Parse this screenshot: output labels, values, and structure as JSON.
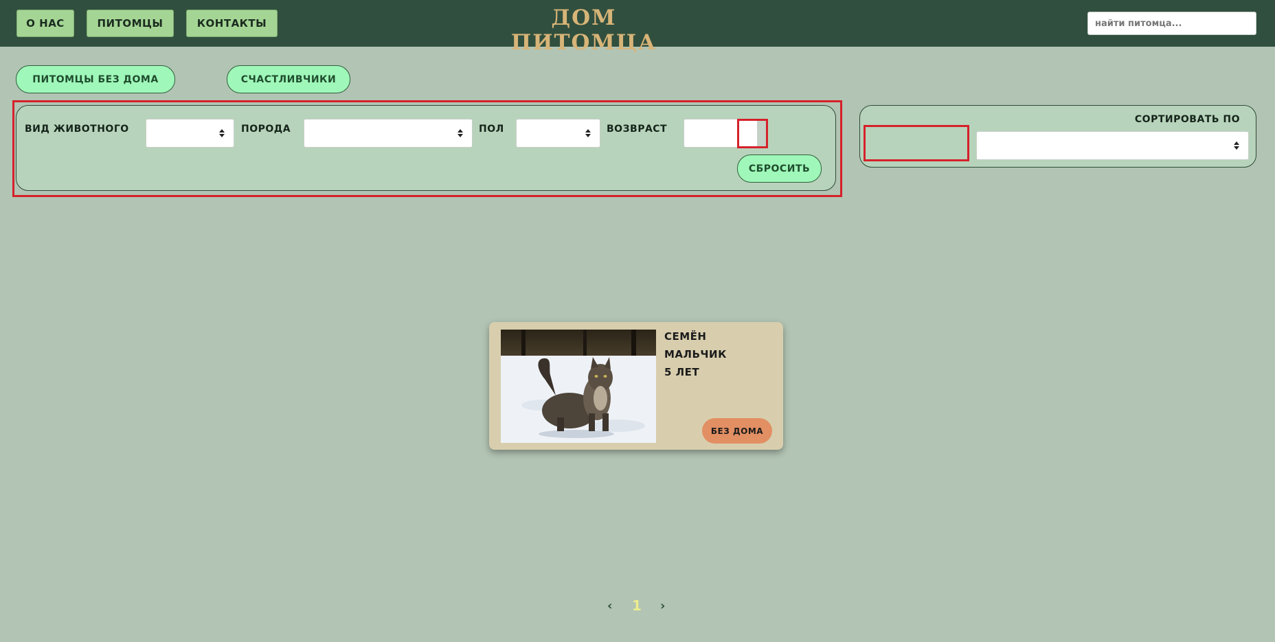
{
  "nav": {
    "about": "О НАС",
    "pets": "ПИТОМЦЫ",
    "contacts": "КОНТАКТЫ"
  },
  "site_title": "ДОМ ПИТОМЦА",
  "search": {
    "placeholder": "найти питомца..."
  },
  "categories": {
    "homeless": "ПИТОМЦЫ БЕЗ ДОМА",
    "lucky": "СЧАСТЛИВЧИКИ"
  },
  "filters": {
    "animal_type_label": "ВИД ЖИВОТНОГО",
    "breed_label": "ПОРОДА",
    "gender_label": "ПОЛ",
    "age_label": "ВОЗВРАСТ",
    "reset": "СБРОСИТЬ"
  },
  "sort": {
    "label": "СОРТИРОВАТЬ ПО"
  },
  "pet": {
    "name": "СЕМЁН",
    "gender": "МАЛЬЧИК",
    "age": "5 ЛЕТ",
    "status": "БЕЗ ДОМА"
  },
  "pagination": {
    "prev": "‹",
    "current": "1",
    "next": "›"
  },
  "colors": {
    "background": "#b2c4b4",
    "header": "#314f3e",
    "title": "#d7b478",
    "accent_green": "#9ff7b9",
    "status_orange": "#e28f63",
    "highlight_red": "#d5212b"
  }
}
